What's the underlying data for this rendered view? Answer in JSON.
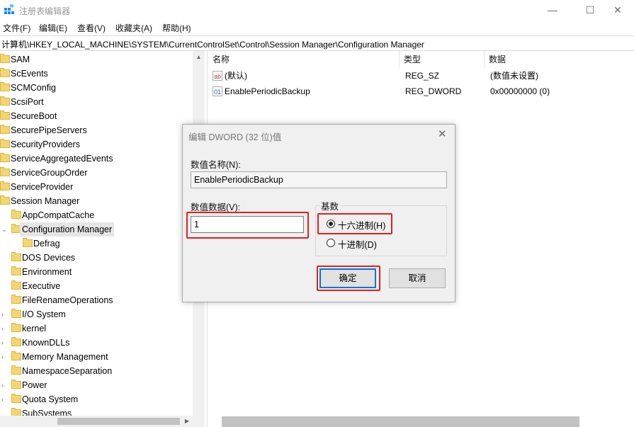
{
  "window": {
    "title": "注册表编辑器",
    "minimize": "—",
    "maximize": "☐",
    "close": "✕"
  },
  "menu": [
    "文件(F)",
    "编辑(E)",
    "查看(V)",
    "收藏夹(A)",
    "帮助(H)"
  ],
  "address": "计算机\\HKEY_LOCAL_MACHINE\\SYSTEM\\CurrentControlSet\\Control\\Session Manager\\Configuration Manager",
  "tree": [
    {
      "label": "SAM",
      "level": 0,
      "expander": false
    },
    {
      "label": "ScEvents",
      "level": 0,
      "expander": false
    },
    {
      "label": "SCMConfig",
      "level": 0,
      "expander": false
    },
    {
      "label": "ScsiPort",
      "level": 0,
      "expander": false
    },
    {
      "label": "SecureBoot",
      "level": 0,
      "expander": false
    },
    {
      "label": "SecurePipeServers",
      "level": 0,
      "expander": false
    },
    {
      "label": "SecurityProviders",
      "level": 0,
      "expander": false
    },
    {
      "label": "ServiceAggregatedEvents",
      "level": 0,
      "expander": false
    },
    {
      "label": "ServiceGroupOrder",
      "level": 0,
      "expander": false
    },
    {
      "label": "ServiceProvider",
      "level": 0,
      "expander": false
    },
    {
      "label": "Session Manager",
      "level": 0,
      "expander": false
    },
    {
      "label": "AppCompatCache",
      "level": 1,
      "expander": false
    },
    {
      "label": "Configuration Manager",
      "level": 1,
      "expander": true,
      "selected": true
    },
    {
      "label": "Defrag",
      "level": 2,
      "expander": false
    },
    {
      "label": "DOS Devices",
      "level": 1,
      "expander": false
    },
    {
      "label": "Environment",
      "level": 1,
      "expander": false
    },
    {
      "label": "Executive",
      "level": 1,
      "expander": false
    },
    {
      "label": "FileRenameOperations",
      "level": 1,
      "expander": false
    },
    {
      "label": "I/O System",
      "level": 1,
      "expander": true
    },
    {
      "label": "kernel",
      "level": 1,
      "expander": true
    },
    {
      "label": "KnownDLLs",
      "level": 1,
      "expander": true
    },
    {
      "label": "Memory Management",
      "level": 1,
      "expander": true
    },
    {
      "label": "NamespaceSeparation",
      "level": 1,
      "expander": false
    },
    {
      "label": "Power",
      "level": 1,
      "expander": true
    },
    {
      "label": "Quota System",
      "level": 1,
      "expander": true
    },
    {
      "label": "SubSystems",
      "level": 1,
      "expander": false
    }
  ],
  "list": {
    "headers": {
      "name": "名称",
      "type": "类型",
      "data": "数据"
    },
    "rows": [
      {
        "icon": "string-value-icon",
        "icon_text": "ab",
        "name": "(默认)",
        "type": "REG_SZ",
        "data": "(数值未设置)"
      },
      {
        "icon": "binary-value-icon",
        "icon_text": "01",
        "name": "EnablePeriodicBackup",
        "type": "REG_DWORD",
        "data": "0x00000000 (0)"
      }
    ]
  },
  "dialog": {
    "title": "编辑 DWORD (32 位)值",
    "close": "✕",
    "name_label": "数值名称(N):",
    "name_value": "EnablePeriodicBackup",
    "data_label": "数值数据(V):",
    "data_value": "1",
    "base_label": "基数",
    "hex_label": "十六进制(H)",
    "dec_label": "十进制(D)",
    "selected_base": "hex",
    "ok": "确定",
    "cancel": "取消"
  },
  "colors": {
    "highlight": "#e0201c",
    "accent": "#0078d7",
    "folder": "#f5d66e"
  }
}
